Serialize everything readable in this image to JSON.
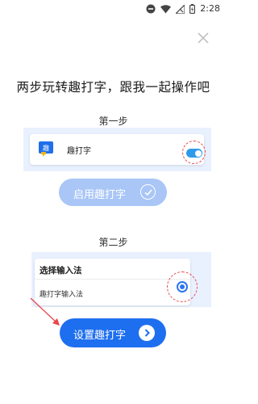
{
  "status_bar": {
    "time": "2:28"
  },
  "headline": "两步玩转趣打字，跟我一起操作吧",
  "step1": {
    "label": "第一步",
    "app_name": "趣打字",
    "toggle_on": true,
    "enable_button": "启用趣打字"
  },
  "step2": {
    "label": "第二步",
    "picker_title": "选择输入法",
    "option": "趣打字输入法",
    "selected": true,
    "setup_button": "设置趣打字"
  },
  "colors": {
    "primary": "#1e6ff0",
    "primary_disabled": "#a9c6f7",
    "panel_bg": "#e9f1ff",
    "toggle": "#2e9bea",
    "highlight": "#e8474c"
  },
  "icons": [
    "minus-circle-icon",
    "wifi-icon",
    "signal-off-icon",
    "battery-icon",
    "close-icon",
    "app-logo-icon",
    "check-icon",
    "chevron-right-icon",
    "pointer-arrow-icon"
  ]
}
